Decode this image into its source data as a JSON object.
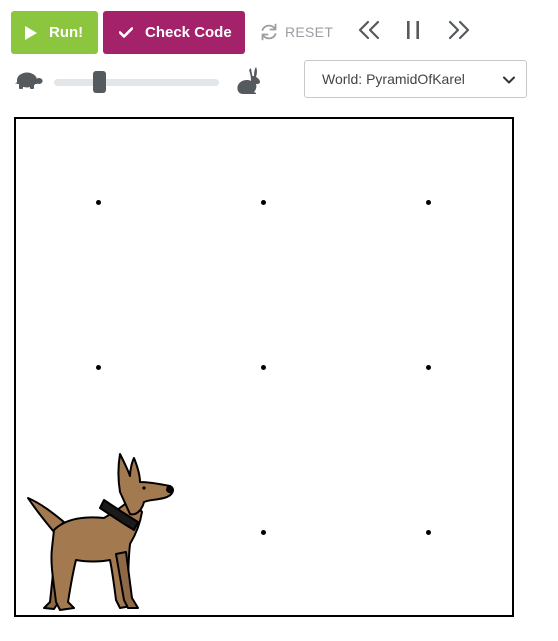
{
  "toolbar": {
    "run_label": "Run!",
    "check_label": "Check Code",
    "reset_label": "RESET",
    "colors": {
      "run": "#8cc63f",
      "check": "#a3226a",
      "reset_text": "#9a9ea3",
      "icon": "#555a5f"
    },
    "icons": {
      "run": "play-icon",
      "check": "checkmark-icon",
      "reset": "refresh-icon",
      "step_back": "double-chevron-left-icon",
      "pause": "pause-icon",
      "step_forward": "double-chevron-right-icon"
    }
  },
  "speed": {
    "slow_icon": "turtle-icon",
    "fast_icon": "rabbit-icon",
    "level": 0.27
  },
  "world_select": {
    "selected_label": "World: PyramidOfKarel",
    "icon": "chevron-down-icon"
  },
  "world": {
    "rows": 3,
    "cols": 3,
    "karel_position": {
      "street": 1,
      "avenue": 1
    },
    "karel_icon": "karel-dog"
  }
}
